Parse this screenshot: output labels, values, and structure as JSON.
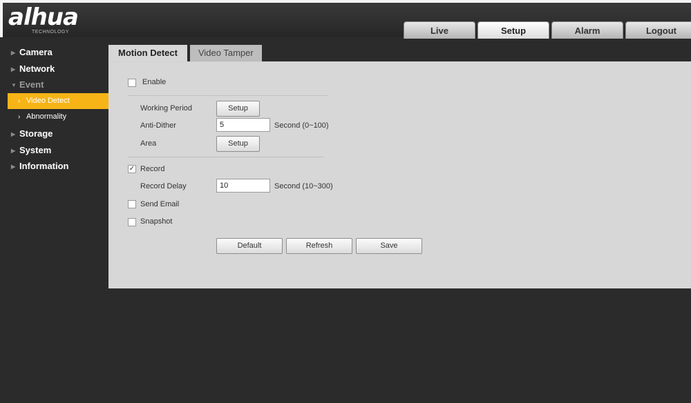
{
  "header": {
    "brand": "alhua",
    "brand_sub": "TECHNOLOGY",
    "tabs": [
      {
        "label": "Live"
      },
      {
        "label": "Setup"
      },
      {
        "label": "Alarm"
      },
      {
        "label": "Logout"
      }
    ]
  },
  "sidebar": {
    "items": [
      {
        "label": "Camera"
      },
      {
        "label": "Network"
      },
      {
        "label": "Event"
      },
      {
        "label": "Video Detect"
      },
      {
        "label": "Abnormality"
      },
      {
        "label": "Storage"
      },
      {
        "label": "System"
      },
      {
        "label": "Information"
      }
    ]
  },
  "content": {
    "tabs": [
      {
        "label": "Motion Detect"
      },
      {
        "label": "Video Tamper"
      }
    ],
    "enable_label": "Enable",
    "working_period_label": "Working Period",
    "working_period_button": "Setup",
    "anti_dither_label": "Anti-Dither",
    "anti_dither_value": "5",
    "anti_dither_unit": "Second (0~100)",
    "area_label": "Area",
    "area_button": "Setup",
    "record_label": "Record",
    "record_checked": "✓",
    "record_delay_label": "Record Delay",
    "record_delay_value": "10",
    "record_delay_unit": "Second (10~300)",
    "send_email_label": "Send Email",
    "snapshot_label": "Snapshot",
    "default_button": "Default",
    "refresh_button": "Refresh",
    "save_button": "Save"
  },
  "colors": {
    "accent": "#f7b417",
    "background": "#2b2b2b",
    "panel": "#d7d7d7"
  }
}
